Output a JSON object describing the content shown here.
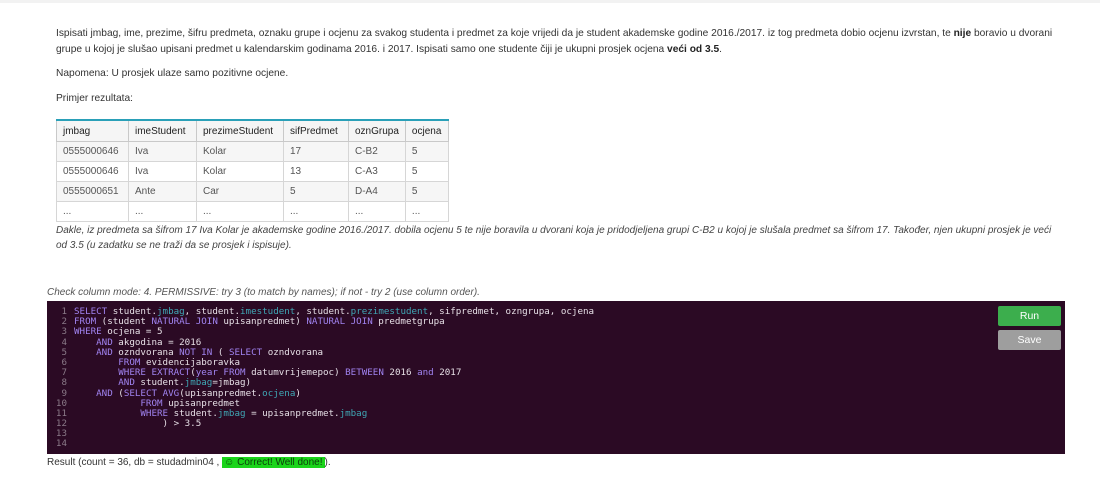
{
  "task": {
    "p1_a": "Ispisati jmbag, ime, prezime, šifru predmeta, oznaku grupe i ocjenu za svakog studenta i predmet za koje vrijedi da je student akademske godine 2016./2017. iz tog predmeta dobio ocjenu izvrstan, te ",
    "p1_b": "nije",
    "p1_c": " boravio u dvorani grupe u kojoj je slušao upisani predmet u kalendarskim godinama 2016. i 2017. Ispisati samo one studente čiji je ukupni prosjek ocjena ",
    "p1_d": "veći od 3.5",
    "p1_e": ".",
    "p2": "Napomena: U prosjek ulaze samo pozitivne ocjene.",
    "p3": "Primjer rezultata:"
  },
  "example_table": {
    "headers": [
      "jmbag",
      "imeStudent",
      "prezimeStudent",
      "sifPredmet",
      "oznGrupa",
      "ocjena"
    ],
    "rows": [
      [
        "0555000646",
        "Iva",
        "Kolar",
        "17",
        "C-B2",
        "5"
      ],
      [
        "0555000646",
        "Iva",
        "Kolar",
        "13",
        "C-A3",
        "5"
      ],
      [
        "0555000651",
        "Ante",
        "Car",
        "5",
        "D-A4",
        "5"
      ],
      [
        "...",
        "...",
        "...",
        "...",
        "...",
        "..."
      ]
    ]
  },
  "explanation": "Dakle, iz predmeta sa šifrom 17 Iva Kolar je akademske godine 2016./2017. dobila ocjenu 5 te nije boravila u dvorani koja je pridodjeljena grupi C-B2 u kojoj je slušala predmet sa šifrom 17. Također, njen ukupni prosjek je veći od 3.5 (u zadatku se ne traži da se prosjek i ispisuje).",
  "check_mode": "Check column mode: 4. PERMISSIVE: try 3 (to match by names); if not - try 2 (use column order).",
  "editor": {
    "line_numbers": [
      "1",
      "2",
      "3",
      "4",
      "5",
      "6",
      "7",
      "8",
      "9",
      "10",
      "11",
      "12",
      "13",
      "14"
    ]
  },
  "buttons": {
    "run": "Run",
    "save": "Save"
  },
  "result": {
    "prefix": "Result (count = 36, db = studadmin04 , ",
    "status": "☺ Correct! Well done!",
    "suffix": ")."
  },
  "colors": {
    "editor_bg": "#2b0a24",
    "keyword": "#a083f0",
    "column": "#3fa7b5",
    "run": "#3cae4d",
    "save": "#9e9e9e",
    "correct": "#1ad41a"
  }
}
